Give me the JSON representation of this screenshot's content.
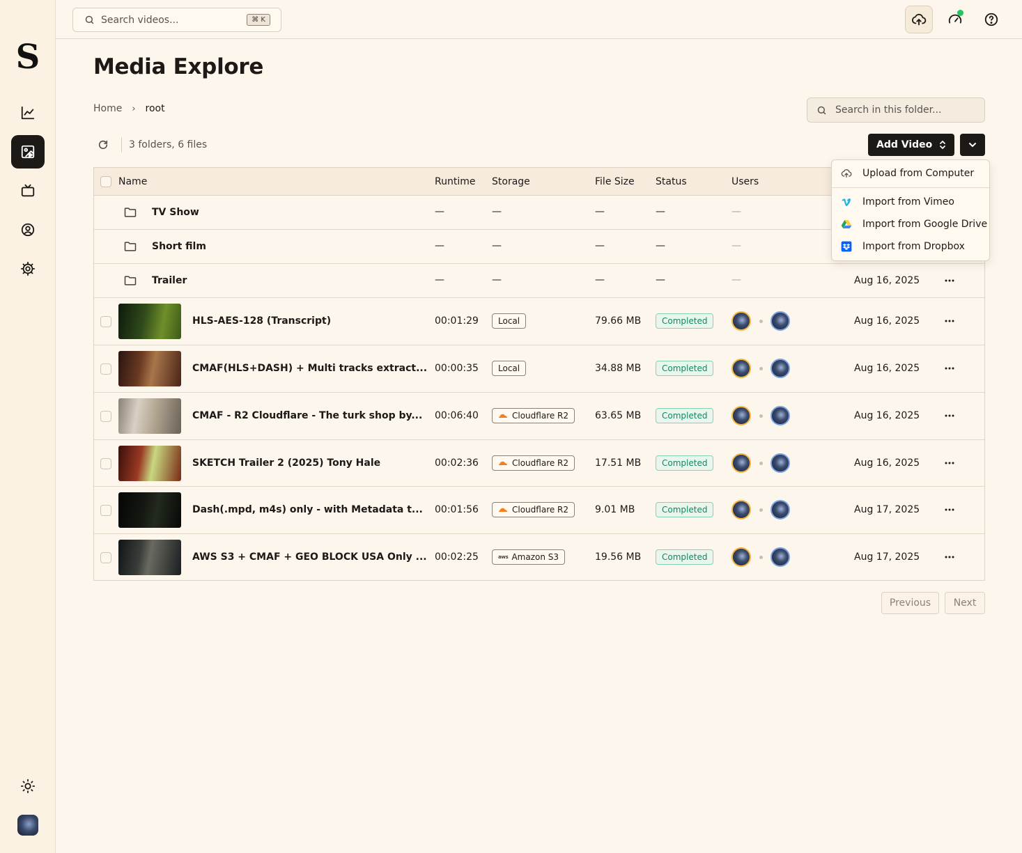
{
  "topbar": {
    "search_placeholder": "Search videos...",
    "search_shortcut": "⌘ K"
  },
  "page": {
    "title": "Media Explore",
    "breadcrumb": [
      "Home",
      "root"
    ],
    "folder_search_placeholder": "Search in this folder...",
    "counts": "3 folders, 6 files",
    "add_video_label": "Add Video"
  },
  "table": {
    "columns": [
      "Name",
      "Runtime",
      "Storage",
      "File Size",
      "Status",
      "Users"
    ],
    "folders": [
      {
        "name": "TV Show",
        "runtime": "—",
        "storage": "—",
        "size": "—",
        "status": "—",
        "users": "—",
        "date": ""
      },
      {
        "name": "Short film",
        "runtime": "—",
        "storage": "—",
        "size": "—",
        "status": "—",
        "users": "—",
        "date": ""
      },
      {
        "name": "Trailer",
        "runtime": "—",
        "storage": "—",
        "size": "—",
        "status": "—",
        "users": "—",
        "date": "Aug 16, 2025"
      }
    ],
    "files": [
      {
        "name": "HLS-AES-128 (Transcript)",
        "runtime": "00:01:29",
        "storage": "Local",
        "storage_icon": "none",
        "size": "79.66 MB",
        "status": "Completed",
        "date": "Aug 16, 2025"
      },
      {
        "name": "CMAF(HLS+DASH) + Multi tracks extract...",
        "runtime": "00:00:35",
        "storage": "Local",
        "storage_icon": "none",
        "size": "34.88 MB",
        "status": "Completed",
        "date": "Aug 16, 2025"
      },
      {
        "name": "CMAF - R2 Cloudflare - The turk shop by...",
        "runtime": "00:06:40",
        "storage": "Cloudflare R2",
        "storage_icon": "cloudflare-icon",
        "size": "63.65 MB",
        "status": "Completed",
        "date": "Aug 16, 2025"
      },
      {
        "name": "SKETCH Trailer 2 (2025) Tony Hale",
        "runtime": "00:02:36",
        "storage": "Cloudflare R2",
        "storage_icon": "cloudflare-icon",
        "size": "17.51 MB",
        "status": "Completed",
        "date": "Aug 16, 2025"
      },
      {
        "name": "Dash(.mpd, m4s) only - with Metadata t...",
        "runtime": "00:01:56",
        "storage": "Cloudflare R2",
        "storage_icon": "cloudflare-icon",
        "size": "9.01 MB",
        "status": "Completed",
        "date": "Aug 17, 2025"
      },
      {
        "name": "AWS S3 + CMAF + GEO BLOCK USA Only ...",
        "runtime": "00:02:25",
        "storage": "Amazon S3",
        "storage_icon": "aws-icon",
        "aws_text": "aws",
        "size": "19.56 MB",
        "status": "Completed",
        "date": "Aug 17, 2025"
      }
    ]
  },
  "pagination": {
    "previous": "Previous",
    "next": "Next"
  },
  "menu": {
    "items": [
      {
        "label": "Upload from Computer",
        "icon": "cloud-upload-icon"
      },
      {
        "label": "Import from Vimeo",
        "icon": "vimeo-icon"
      },
      {
        "label": "Import from Google Drive",
        "icon": "google-drive-icon"
      },
      {
        "label": "Import from Dropbox",
        "icon": "dropbox-icon"
      }
    ]
  },
  "colors": {
    "accent": "#1c1917",
    "background": "#fdf6ec",
    "status_green": "#0f8a5f",
    "cloudflare": "#f38020"
  }
}
